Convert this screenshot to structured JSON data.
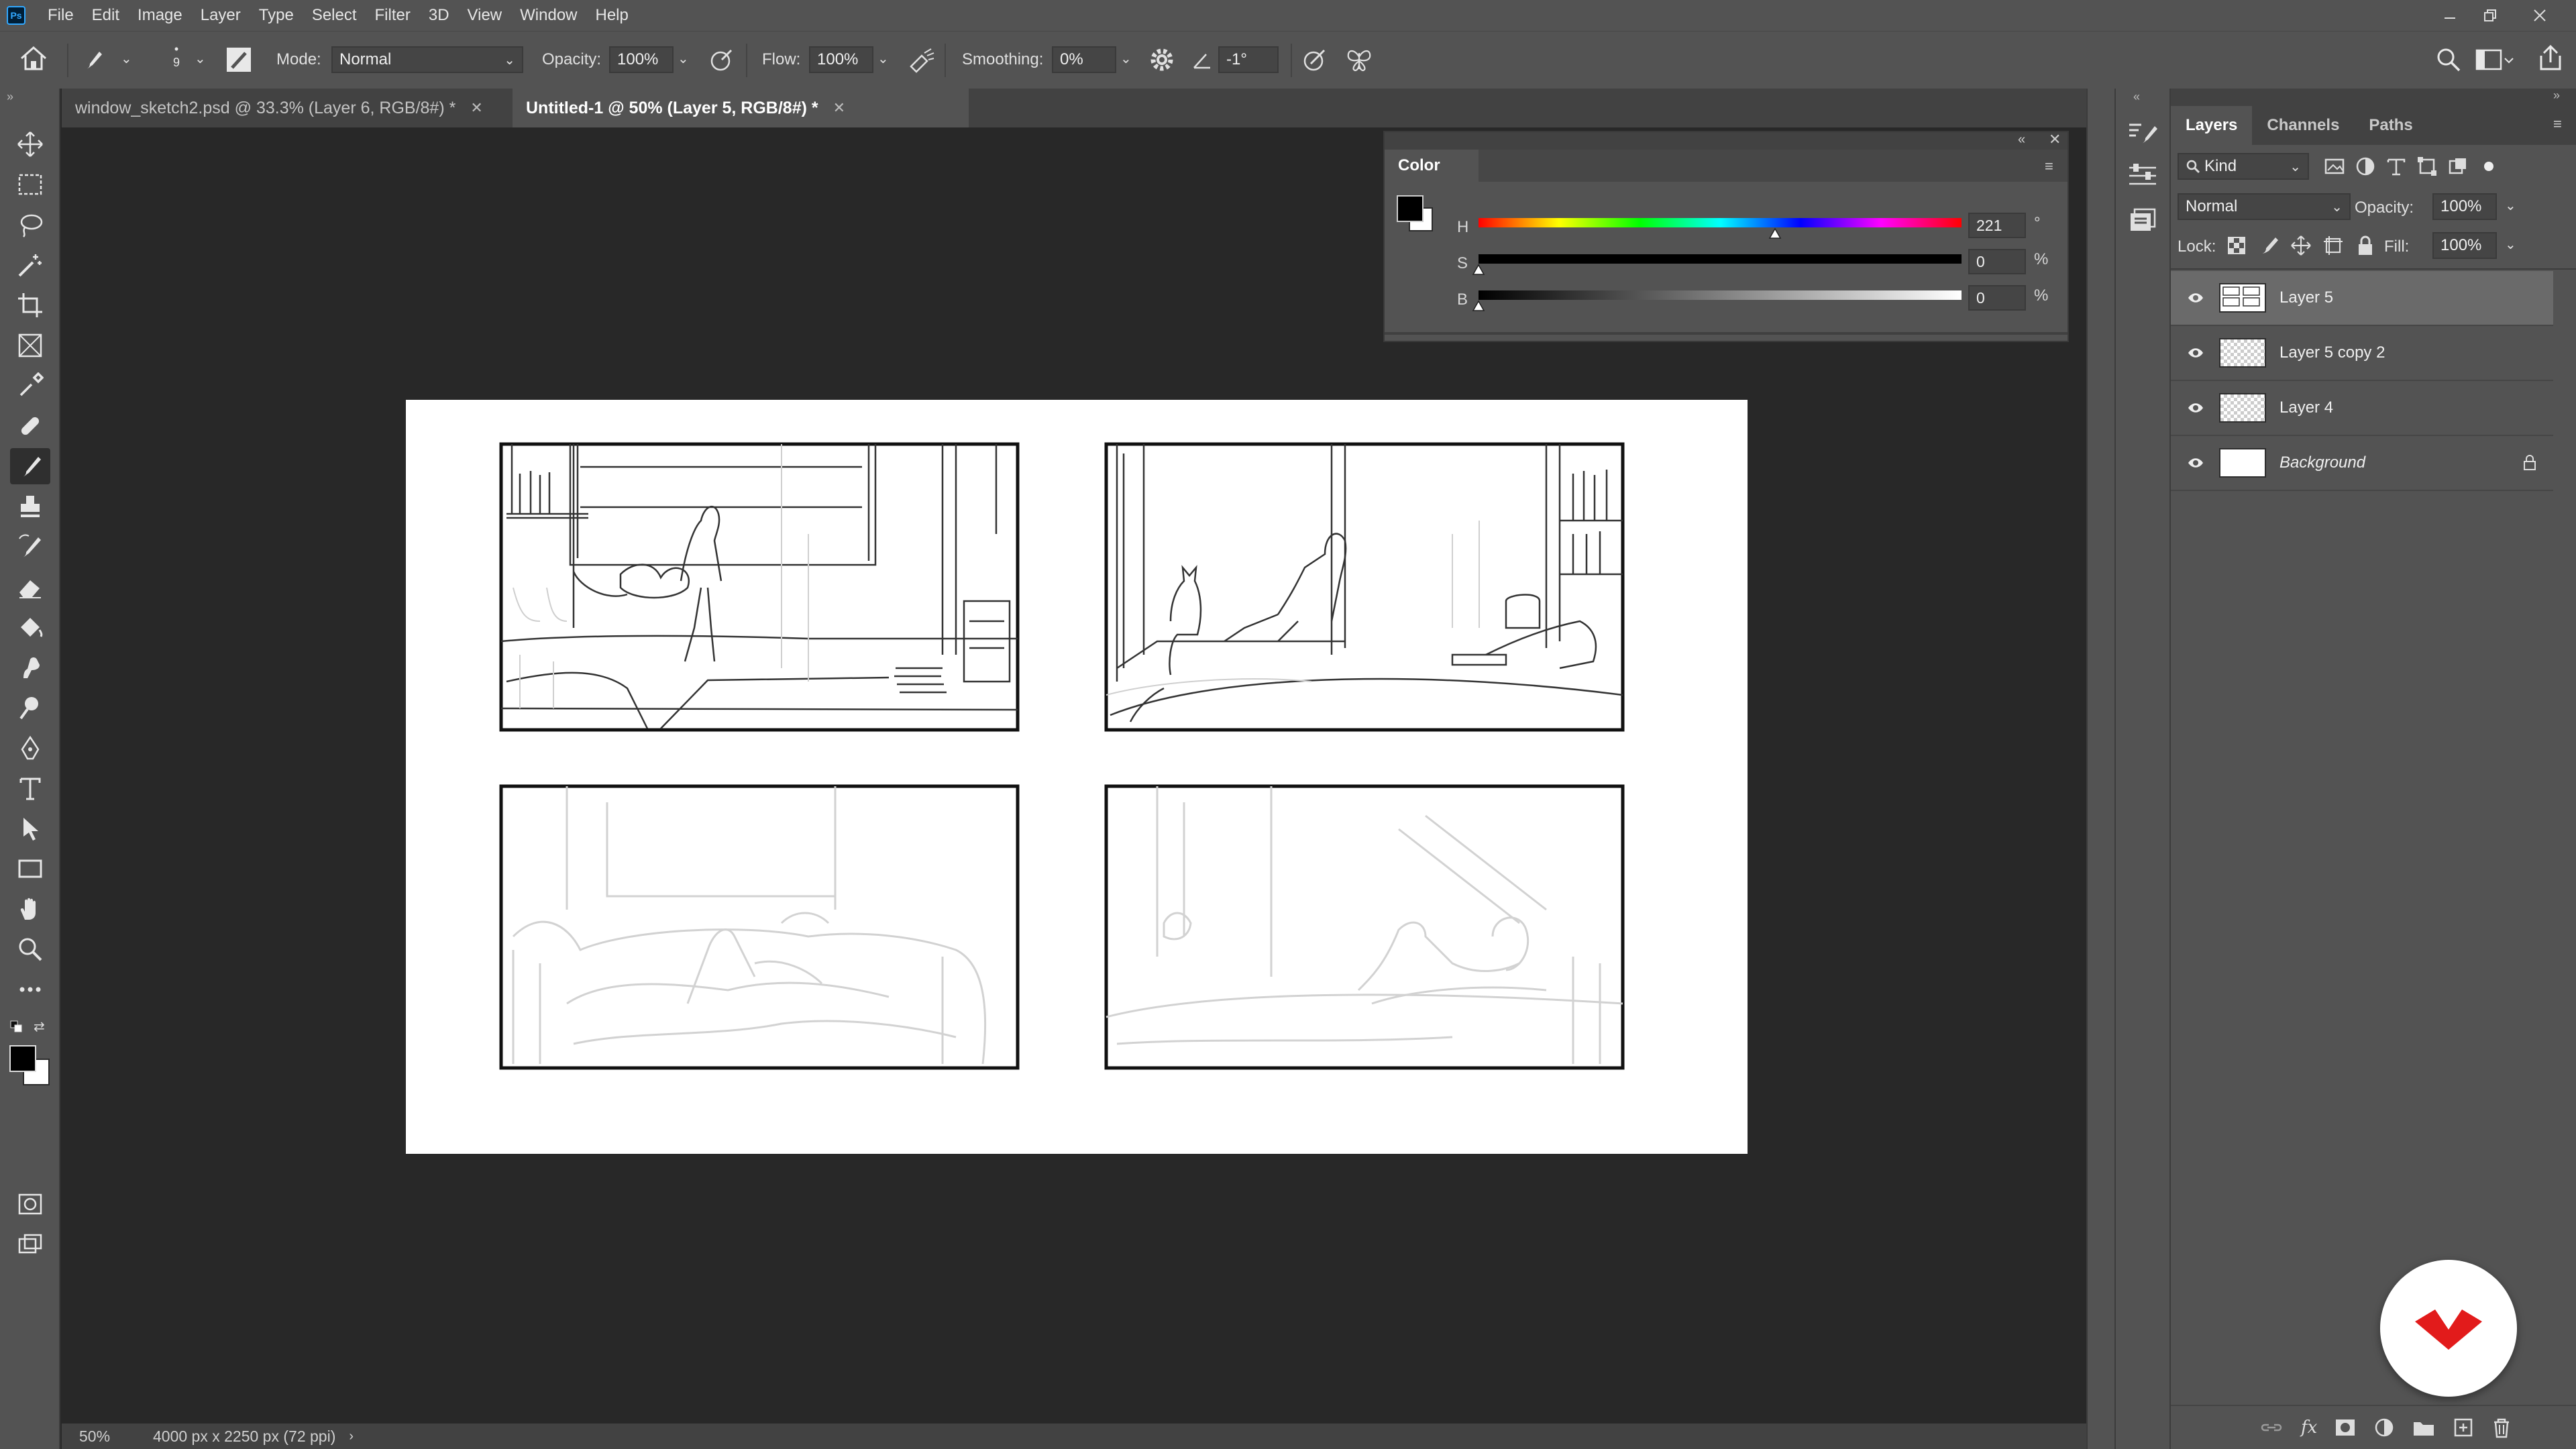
{
  "app": {
    "logo_text": "Ps",
    "menu": [
      "File",
      "Edit",
      "Image",
      "Layer",
      "Type",
      "Select",
      "Filter",
      "3D",
      "View",
      "Window",
      "Help"
    ]
  },
  "options_bar": {
    "brush_size": "9",
    "mode_label": "Mode:",
    "mode_value": "Normal",
    "opacity_label": "Opacity:",
    "opacity_value": "100%",
    "flow_label": "Flow:",
    "flow_value": "100%",
    "smoothing_label": "Smoothing:",
    "smoothing_value": "0%",
    "angle_value": "-1°"
  },
  "tabs": [
    {
      "label": "window_sketch2.psd @ 33.3% (Layer 6, RGB/8#) *",
      "active": false
    },
    {
      "label": "Untitled-1 @ 50% (Layer 5, RGB/8#) *",
      "active": true
    }
  ],
  "color_panel": {
    "title": "Color",
    "h_label": "H",
    "h_value": "221",
    "h_unit": "°",
    "s_label": "S",
    "s_value": "0",
    "s_unit": "%",
    "b_label": "B",
    "b_value": "0",
    "b_unit": "%",
    "h_fraction": 0.614,
    "s_fraction": 0.0,
    "b_fraction": 0.0,
    "foreground": "#000000",
    "background": "#ffffff"
  },
  "layers_panel": {
    "tabs": [
      "Layers",
      "Channels",
      "Paths"
    ],
    "filter_kind": "Kind",
    "blend_mode": "Normal",
    "opacity_label": "Opacity:",
    "opacity_value": "100%",
    "lock_label": "Lock:",
    "fill_label": "Fill:",
    "fill_value": "100%",
    "layers": [
      {
        "name": "Layer 5",
        "selected": true,
        "thumb": "sketch"
      },
      {
        "name": "Layer 5 copy 2",
        "selected": false,
        "thumb": "transparent"
      },
      {
        "name": "Layer 4",
        "selected": false,
        "thumb": "transparent"
      },
      {
        "name": "Background",
        "selected": false,
        "thumb": "white",
        "locked": true
      }
    ]
  },
  "status_bar": {
    "zoom": "50%",
    "doc_info": "4000 px x 2250 px (72 ppi)"
  },
  "colors": {
    "ui_panel": "#535353",
    "ui_dark": "#424242",
    "canvas_bg": "#282828",
    "accent_blue": "#31a8ff",
    "brand_red": "#e21b1b"
  }
}
